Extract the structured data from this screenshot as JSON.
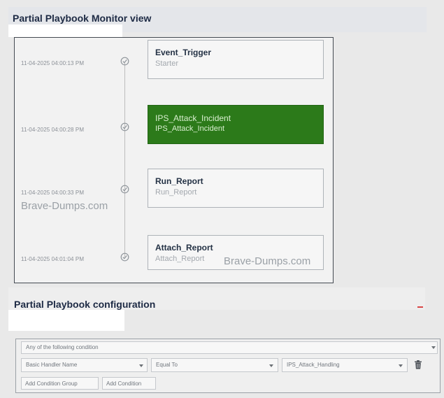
{
  "monitor": {
    "title": "Partial Playbook Monitor view",
    "steps": [
      {
        "timestamp": "11-04-2025 04:00:13 PM",
        "name": "Event_Trigger",
        "subtitle": "Starter",
        "active": false
      },
      {
        "timestamp": "11-04-2025 04:00:28 PM",
        "name": "IPS_Attack_Incident",
        "subtitle": "IPS_Attack_Incident",
        "active": true
      },
      {
        "timestamp": "11-04-2025 04:00:33 PM",
        "name": "Run_Report",
        "subtitle": "Run_Report",
        "active": false
      },
      {
        "timestamp": "11-04-2025 04:01:04 PM",
        "name": "Attach_Report",
        "subtitle": "Attach_Report",
        "active": false
      }
    ],
    "watermarks": [
      "Brave-Dumps.com",
      "Brave-Dumps.com"
    ]
  },
  "configuration": {
    "title": "Partial Playbook configuration",
    "condition_mode": "Any of the following condition",
    "condition": {
      "field": "Basic Handler Name",
      "operator": "Equal To",
      "value": "IPS_Attack_Handling"
    },
    "buttons": {
      "add_group": "Add Condition Group",
      "add_condition": "Add Condition"
    }
  },
  "colors": {
    "active_node": "#2c7a1a",
    "header_text": "#1d2a44"
  },
  "icons": {
    "status": "check-circle-icon",
    "dropdown": "caret-down-icon",
    "delete": "trash-icon"
  }
}
